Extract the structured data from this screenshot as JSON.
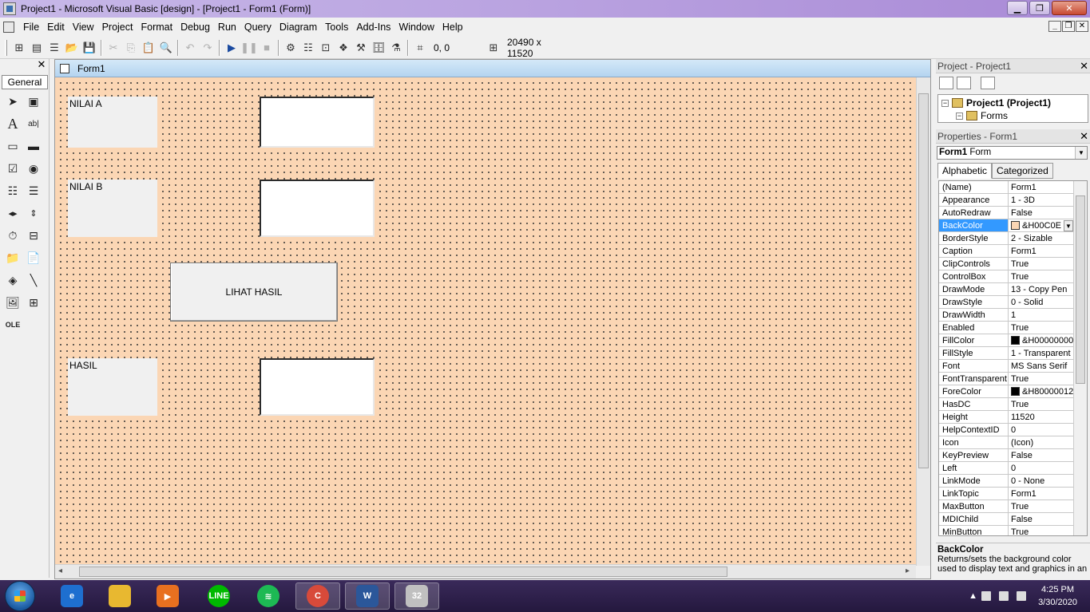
{
  "window": {
    "title": "Project1 - Microsoft Visual Basic [design] - [Project1 - Form1 (Form)]",
    "min_glyph": "▁",
    "max_glyph": "❐",
    "close_glyph": "✕"
  },
  "menu": [
    "File",
    "Edit",
    "View",
    "Project",
    "Format",
    "Debug",
    "Run",
    "Query",
    "Diagram",
    "Tools",
    "Add-Ins",
    "Window",
    "Help"
  ],
  "mdi_buttons": [
    "_",
    "❐",
    "✕"
  ],
  "toolbar": {
    "position": "0, 0",
    "size": "20490 x 11520"
  },
  "toolbox": {
    "tab": "General",
    "close": "✕"
  },
  "designer": {
    "title": "Form1"
  },
  "form": {
    "label1": "NILAI A",
    "label2": "NILAI B",
    "button": "LIHAT HASIL",
    "label3": "HASIL"
  },
  "project_panel": {
    "title": "Project - Project1",
    "root": "Project1 (Project1)",
    "child": "Forms"
  },
  "properties_panel": {
    "title": "Properties - Form1",
    "object_name": "Form1",
    "object_type": "Form",
    "tabs": [
      "Alphabetic",
      "Categorized"
    ],
    "rows": [
      {
        "name": "(Name)",
        "value": "Form1"
      },
      {
        "name": "Appearance",
        "value": "1 - 3D"
      },
      {
        "name": "AutoRedraw",
        "value": "False"
      },
      {
        "name": "BackColor",
        "value": "&H00C0E",
        "swatch": "#fbd6b4",
        "selected": true
      },
      {
        "name": "BorderStyle",
        "value": "2 - Sizable"
      },
      {
        "name": "Caption",
        "value": "Form1"
      },
      {
        "name": "ClipControls",
        "value": "True"
      },
      {
        "name": "ControlBox",
        "value": "True"
      },
      {
        "name": "DrawMode",
        "value": "13 - Copy Pen"
      },
      {
        "name": "DrawStyle",
        "value": "0 - Solid"
      },
      {
        "name": "DrawWidth",
        "value": "1"
      },
      {
        "name": "Enabled",
        "value": "True"
      },
      {
        "name": "FillColor",
        "value": "&H00000000",
        "swatch": "#000000"
      },
      {
        "name": "FillStyle",
        "value": "1 - Transparent"
      },
      {
        "name": "Font",
        "value": "MS Sans Serif"
      },
      {
        "name": "FontTransparent",
        "value": "True"
      },
      {
        "name": "ForeColor",
        "value": "&H80000012",
        "swatch": "#000000"
      },
      {
        "name": "HasDC",
        "value": "True"
      },
      {
        "name": "Height",
        "value": "11520"
      },
      {
        "name": "HelpContextID",
        "value": "0"
      },
      {
        "name": "Icon",
        "value": "(Icon)"
      },
      {
        "name": "KeyPreview",
        "value": "False"
      },
      {
        "name": "Left",
        "value": "0"
      },
      {
        "name": "LinkMode",
        "value": "0 - None"
      },
      {
        "name": "LinkTopic",
        "value": "Form1"
      },
      {
        "name": "MaxButton",
        "value": "True"
      },
      {
        "name": "MDIChild",
        "value": "False"
      },
      {
        "name": "MinButton",
        "value": "True"
      }
    ],
    "desc_title": "BackColor",
    "desc_text": "Returns/sets the background color used to display text and graphics in an"
  },
  "taskbar": {
    "time": "4:25 PM",
    "date": "3/30/2020",
    "apps": [
      {
        "name": "ie",
        "label": "e",
        "color": "#1e6fd0"
      },
      {
        "name": "explorer",
        "label": "",
        "color": "#e8b830"
      },
      {
        "name": "media-player",
        "label": "▶",
        "color": "#e87020"
      },
      {
        "name": "line",
        "label": "LINE",
        "color": "#00b900"
      },
      {
        "name": "spotify",
        "label": "≋",
        "color": "#1db954"
      },
      {
        "name": "chrome",
        "label": "C",
        "color": "#d84a3a"
      },
      {
        "name": "word",
        "label": "W",
        "color": "#2b579a"
      },
      {
        "name": "vb6",
        "label": "32",
        "color": "#c0c0c0"
      }
    ]
  }
}
